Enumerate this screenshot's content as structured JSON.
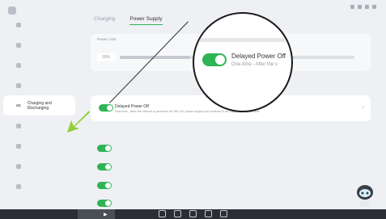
{
  "tabs": [
    {
      "label": "Charging",
      "active": false
    },
    {
      "label": "Power Supply",
      "active": true
    }
  ],
  "sidebar": {
    "items": [
      {
        "icon": "network-icon",
        "label": "",
        "active": false
      },
      {
        "icon": "display-icon",
        "label": "",
        "active": false
      },
      {
        "icon": "sound-icon",
        "label": "",
        "active": false
      },
      {
        "icon": "security-icon",
        "label": "",
        "active": false
      },
      {
        "icon": "plug-icon",
        "label": "Charging and Discharging",
        "active": true
      },
      {
        "icon": "intelligent-icon",
        "label": "",
        "active": false
      },
      {
        "icon": "engine-icon",
        "label": "",
        "active": false
      },
      {
        "icon": "connection-icon",
        "label": "",
        "active": false
      },
      {
        "icon": "general-icon",
        "label": "",
        "active": false
      }
    ]
  },
  "power_limit": {
    "title": "Power Limit",
    "value_text": "30%",
    "value": 0.3
  },
  "delayed_power_off": {
    "title": "Delayed Power Off",
    "description": "One-time - After the vehicle is powered off, the 12V power supply will continue to be supplied for a set time",
    "enabled": true
  },
  "wireless_rows": [
    {
      "label": "",
      "enabled": true
    },
    {
      "label": "",
      "enabled": true
    },
    {
      "label": "",
      "enabled": true
    },
    {
      "label": "",
      "enabled": true
    }
  ],
  "magnifier": {
    "title": "Delayed Power Off",
    "description": "One-time - After the v"
  },
  "colors": {
    "accent": "#2fb455",
    "arrow": "#8fcf3a",
    "background": "#eef0f4"
  }
}
